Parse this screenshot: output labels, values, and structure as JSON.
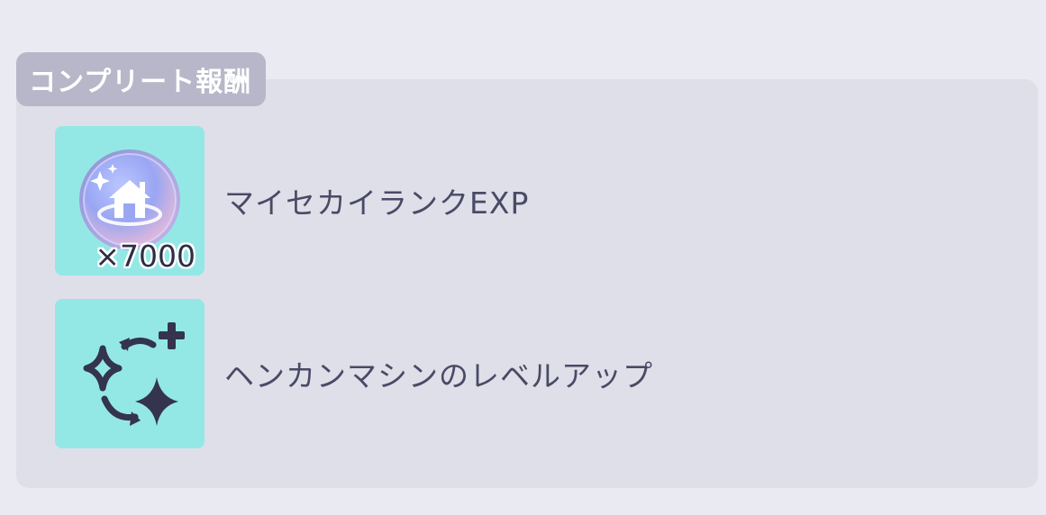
{
  "section": {
    "title": "コンプリート報酬"
  },
  "rewards": [
    {
      "label": "マイセカイランクEXP",
      "quantity": "×7000",
      "icon": "house-medal-icon",
      "tile_color": "#93e8e6"
    },
    {
      "label": "ヘンカンマシンのレベルアップ",
      "icon": "sparkle-levelup-icon",
      "tile_color": "#93e8e6"
    }
  ],
  "colors": {
    "background": "#eaeaf3",
    "panel": "#dfdfe9",
    "tab": "#b7b7c9",
    "text": "#4a4a66",
    "icon_dark": "#34344e"
  }
}
